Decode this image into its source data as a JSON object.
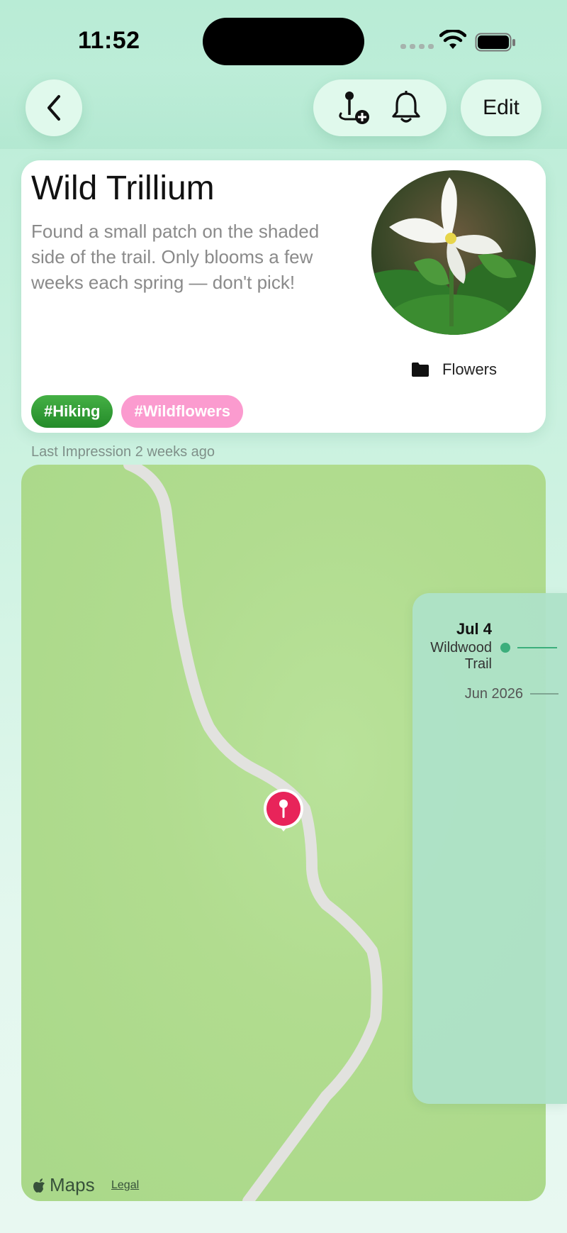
{
  "status_bar": {
    "time": "11:52"
  },
  "nav": {
    "edit_label": "Edit"
  },
  "item": {
    "title": "Wild Trillium",
    "description": "Found a small patch on the shaded side of the trail. Only blooms a few weeks each spring — don't pick!",
    "folder": "Flowers",
    "tags": [
      "#Hiking",
      "#Wildflowers"
    ],
    "last_impression": "Last Impression 2 weeks ago"
  },
  "map": {
    "attribution": "Maps",
    "legal": "Legal"
  },
  "timeline": {
    "entry_date": "Jul 4",
    "entry_place": "Wildwood Trail",
    "month_label": "Jun 2026"
  },
  "colors": {
    "accent_green": "#3cae7c",
    "tag_hiking": "#2e9a33",
    "tag_wildflowers": "#fb9bcf",
    "pin": "#e8245a"
  }
}
